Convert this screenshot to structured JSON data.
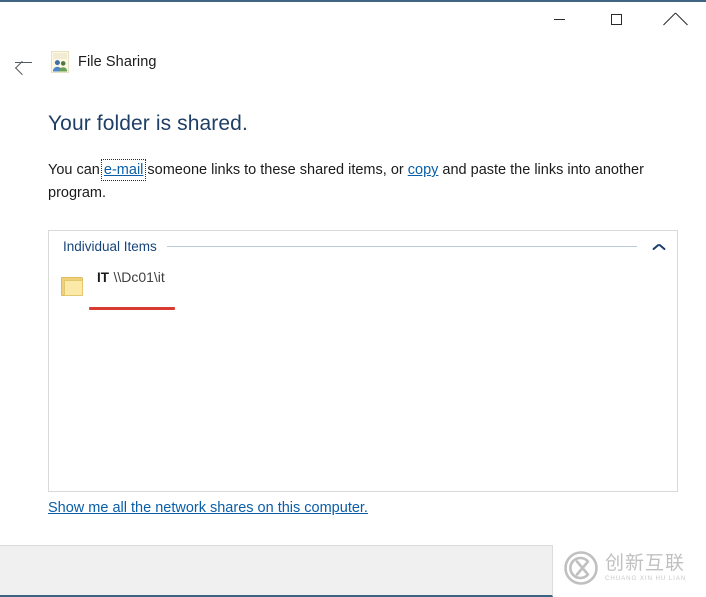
{
  "window": {
    "title": "File Sharing",
    "app_icon": "file-sharing-icon",
    "back_icon": "back-arrow-icon",
    "controls": {
      "minimize": "minimize-icon",
      "maximize": "maximize-icon",
      "close": "close-icon"
    }
  },
  "main": {
    "heading": "Your folder is shared.",
    "description": {
      "part1": "You can ",
      "email_link": "e-mail",
      "part2": " someone links to these shared items, or ",
      "copy_link": "copy",
      "part3": " and paste the links into another program."
    },
    "group": {
      "title": "Individual Items",
      "collapse_icon": "chevron-up-icon",
      "items": [
        {
          "icon": "folder-icon",
          "name": "IT",
          "path": "\\\\Dc01\\it"
        }
      ]
    },
    "network_shares_link": "Show me all the network shares on this computer."
  },
  "watermark": {
    "logo": "cx-circle-logo",
    "cn": "创新互联",
    "en": "CHUANG XIN HU LIAN"
  },
  "colors": {
    "heading": "#1f3f66",
    "link": "#0a5ea8",
    "group_title": "#17457a",
    "accent_border": "#3d6480",
    "annotation_red": "#d73b32",
    "folder_yellow": "#f0d17a"
  }
}
